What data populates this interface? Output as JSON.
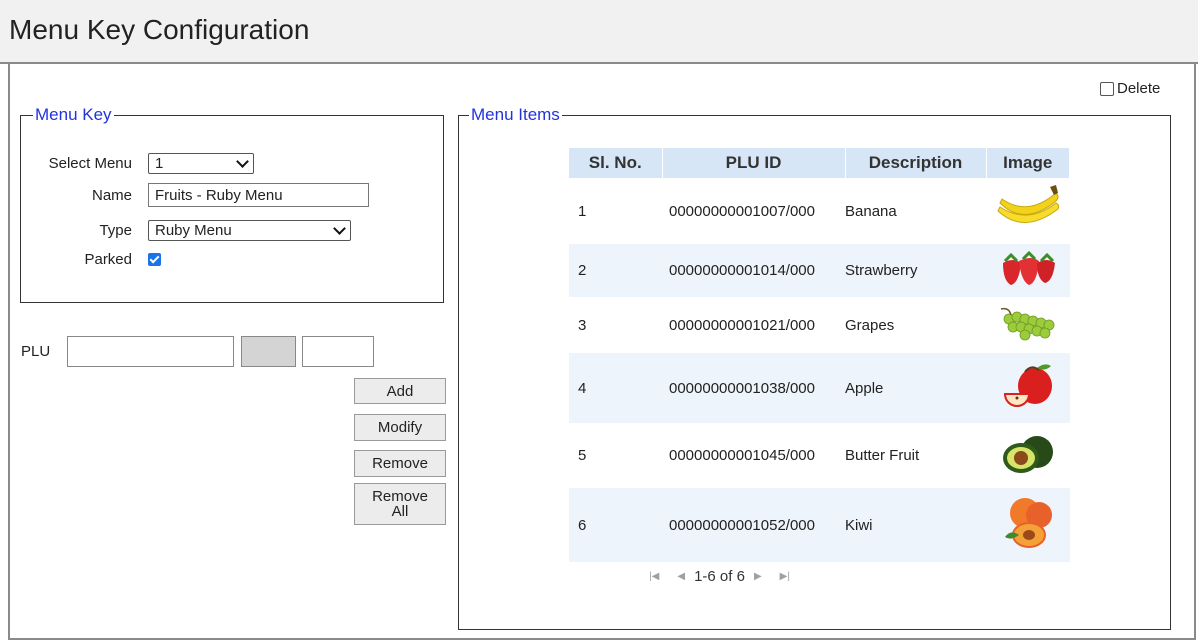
{
  "title": "Menu Key Configuration",
  "delete_label": "Delete",
  "menu_key": {
    "legend": "Menu Key",
    "select_menu_label": "Select Menu",
    "select_menu_value": "1",
    "name_label": "Name",
    "name_value": "Fruits - Ruby Menu",
    "type_label": "Type",
    "type_value": "Ruby Menu",
    "parked_label": "Parked"
  },
  "plu": {
    "label": "PLU"
  },
  "buttons": {
    "add": "Add",
    "modify": "Modify",
    "remove": "Remove",
    "remove_all_1": "Remove",
    "remove_all_2": "All"
  },
  "menu_items": {
    "legend": "Menu Items",
    "headers": [
      "Sl. No.",
      "PLU ID",
      "Description",
      "Image"
    ],
    "rows": [
      {
        "no": "1",
        "plu": "00000000001007/000",
        "desc": "Banana",
        "icon": "banana-image"
      },
      {
        "no": "2",
        "plu": "00000000001014/000",
        "desc": "Strawberry",
        "icon": "strawberry-image"
      },
      {
        "no": "3",
        "plu": "00000000001021/000",
        "desc": "Grapes",
        "icon": "grapes-image"
      },
      {
        "no": "4",
        "plu": "00000000001038/000",
        "desc": "Apple",
        "icon": "apple-image"
      },
      {
        "no": "5",
        "plu": "00000000001045/000",
        "desc": "Butter Fruit",
        "icon": "avocado-image"
      },
      {
        "no": "6",
        "plu": "00000000001052/000",
        "desc": "Kiwi",
        "icon": "apricot-image"
      }
    ],
    "pager_text": "1-6 of 6"
  }
}
